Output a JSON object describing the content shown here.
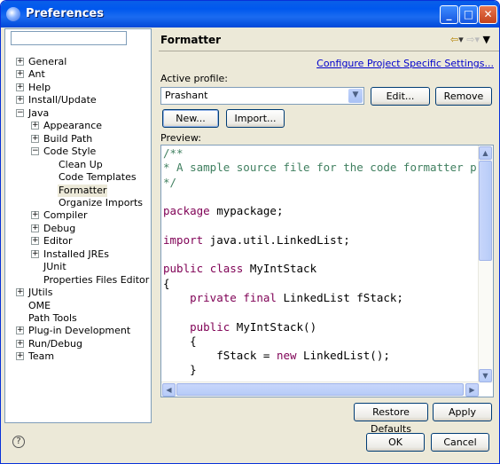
{
  "window": {
    "title": "Preferences"
  },
  "filter": {
    "value": ""
  },
  "tree": [
    {
      "label": "General",
      "level": 0,
      "expander": "+"
    },
    {
      "label": "Ant",
      "level": 0,
      "expander": "+"
    },
    {
      "label": "Help",
      "level": 0,
      "expander": "+"
    },
    {
      "label": "Install/Update",
      "level": 0,
      "expander": "+"
    },
    {
      "label": "Java",
      "level": 0,
      "expander": "-"
    },
    {
      "label": "Appearance",
      "level": 1,
      "expander": "+"
    },
    {
      "label": "Build Path",
      "level": 1,
      "expander": "+"
    },
    {
      "label": "Code Style",
      "level": 1,
      "expander": "-"
    },
    {
      "label": "Clean Up",
      "level": 2,
      "expander": ""
    },
    {
      "label": "Code Templates",
      "level": 2,
      "expander": ""
    },
    {
      "label": "Formatter",
      "level": 2,
      "expander": "",
      "selected": true
    },
    {
      "label": "Organize Imports",
      "level": 2,
      "expander": ""
    },
    {
      "label": "Compiler",
      "level": 1,
      "expander": "+"
    },
    {
      "label": "Debug",
      "level": 1,
      "expander": "+"
    },
    {
      "label": "Editor",
      "level": 1,
      "expander": "+"
    },
    {
      "label": "Installed JREs",
      "level": 1,
      "expander": "+"
    },
    {
      "label": "JUnit",
      "level": 1,
      "expander": ""
    },
    {
      "label": "Properties Files Editor",
      "level": 1,
      "expander": ""
    },
    {
      "label": "JUtils",
      "level": 0,
      "expander": "+"
    },
    {
      "label": "OME",
      "level": 0,
      "expander": ""
    },
    {
      "label": "Path Tools",
      "level": 0,
      "expander": ""
    },
    {
      "label": "Plug-in Development",
      "level": 0,
      "expander": "+"
    },
    {
      "label": "Run/Debug",
      "level": 0,
      "expander": "+"
    },
    {
      "label": "Team",
      "level": 0,
      "expander": "+"
    }
  ],
  "page": {
    "title": "Formatter",
    "configure_link": "Configure Project Specific Settings...",
    "active_profile_label": "Active profile:",
    "profile_value": "Prashant",
    "edit_label": "Edit...",
    "remove_label": "Remove",
    "new_label": "New...",
    "import_label": "Import...",
    "preview_label": "Preview:",
    "restore_label": "Restore Defaults",
    "apply_label": "Apply"
  },
  "code_lines": [
    [
      {
        "t": "/**",
        "c": "cm"
      }
    ],
    [
      {
        "t": "* A sample source file for the code formatter prev",
        "c": "cm"
      }
    ],
    [
      {
        "t": "*/",
        "c": "cm"
      }
    ],
    [
      {
        "t": "",
        "c": ""
      }
    ],
    [
      {
        "t": "package",
        "c": "kw"
      },
      {
        "t": " mypackage;",
        "c": ""
      }
    ],
    [
      {
        "t": "",
        "c": ""
      }
    ],
    [
      {
        "t": "import",
        "c": "kw"
      },
      {
        "t": " java.util.LinkedList;",
        "c": ""
      }
    ],
    [
      {
        "t": "",
        "c": ""
      }
    ],
    [
      {
        "t": "public",
        "c": "kw"
      },
      {
        "t": " ",
        "c": ""
      },
      {
        "t": "class",
        "c": "kw"
      },
      {
        "t": " MyIntStack",
        "c": ""
      }
    ],
    [
      {
        "t": "{",
        "c": ""
      }
    ],
    [
      {
        "t": "    ",
        "c": ""
      },
      {
        "t": "private",
        "c": "kw"
      },
      {
        "t": " ",
        "c": ""
      },
      {
        "t": "final",
        "c": "kw"
      },
      {
        "t": " LinkedList fStack;",
        "c": ""
      }
    ],
    [
      {
        "t": "",
        "c": ""
      }
    ],
    [
      {
        "t": "    ",
        "c": ""
      },
      {
        "t": "public",
        "c": "kw"
      },
      {
        "t": " MyIntStack()",
        "c": ""
      }
    ],
    [
      {
        "t": "    {",
        "c": ""
      }
    ],
    [
      {
        "t": "        fStack = ",
        "c": ""
      },
      {
        "t": "new",
        "c": "kw"
      },
      {
        "t": " LinkedList();",
        "c": ""
      }
    ],
    [
      {
        "t": "    }",
        "c": ""
      }
    ]
  ],
  "dialog": {
    "ok_label": "OK",
    "cancel_label": "Cancel"
  },
  "icons": {
    "help": "help-icon",
    "back": "back-arrow-icon",
    "forward": "forward-arrow-icon",
    "menu": "view-menu-icon"
  }
}
